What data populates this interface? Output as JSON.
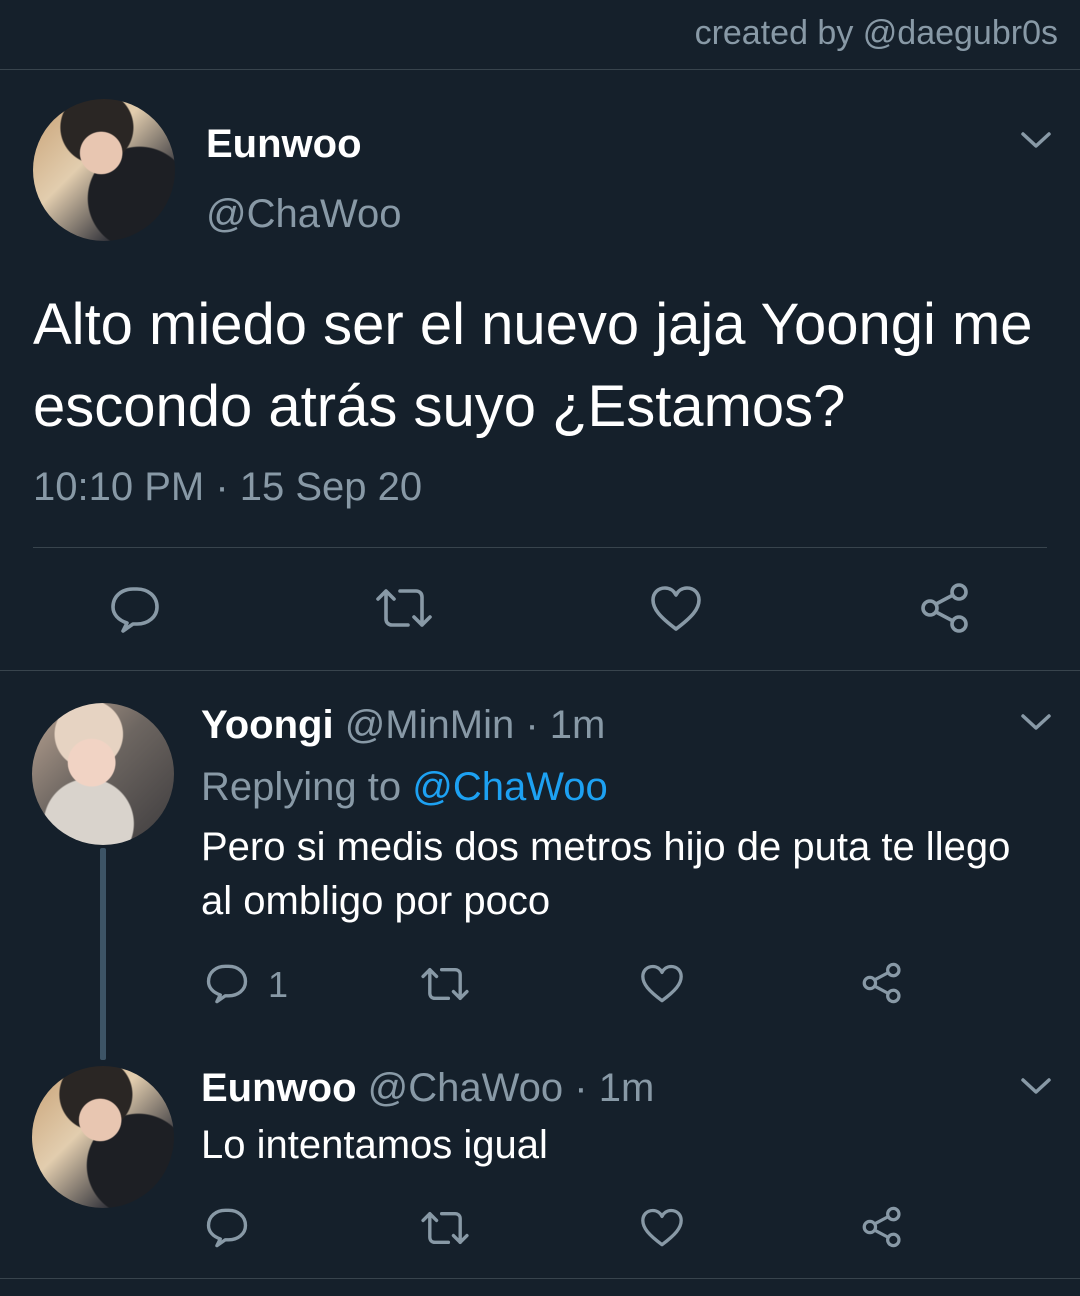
{
  "credit": "created by @daegubr0s",
  "main_tweet": {
    "name": "Eunwoo",
    "handle": "@ChaWoo",
    "text": "Alto miedo ser el nuevo jaja Yoongi me escondo atrás suyo ¿Estamos?",
    "timestamp": "10:10 PM · 15 Sep 20",
    "icons": [
      "reply-icon",
      "retweet-icon",
      "like-icon",
      "share-icon"
    ]
  },
  "replies": [
    {
      "name": "Yoongi",
      "handle_time": "@MinMin · 1m",
      "replying_prefix": "Replying to",
      "replying_to": "@ChaWoo",
      "text": "Pero si medis dos metros hijo de puta te llego al ombligo por poco",
      "reply_count": "1"
    },
    {
      "name": "Eunwoo",
      "handle_time": "@ChaWoo · 1m",
      "text": "Lo intentamos igual"
    }
  ],
  "colors": {
    "background": "#15202b",
    "muted": "#8899a6",
    "link": "#1da1f2",
    "divider": "#38444d"
  }
}
